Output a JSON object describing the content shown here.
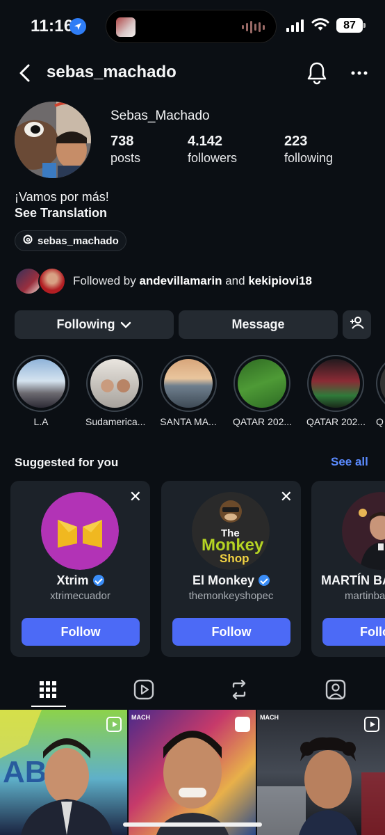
{
  "status_bar": {
    "time": "11:16",
    "battery": "87"
  },
  "header": {
    "username": "sebas_machado"
  },
  "profile": {
    "display_name": "Sebas_Machado",
    "stats": [
      {
        "value": "738",
        "label": "posts"
      },
      {
        "value": "4.142",
        "label": "followers"
      },
      {
        "value": "223",
        "label": "following"
      }
    ],
    "bio": "¡Vamos por más!",
    "see_translation": "See Translation",
    "threads_handle": "sebas_machado",
    "followed_by_prefix": "Followed by ",
    "followed_by_user1": "andevillamarin",
    "followed_by_and": " and ",
    "followed_by_user2": "kekipiovi18"
  },
  "actions": {
    "following": "Following",
    "message": "Message"
  },
  "highlights": [
    {
      "label": "L.A"
    },
    {
      "label": "Sudamerica..."
    },
    {
      "label": "SANTA MA..."
    },
    {
      "label": "QATAR 202..."
    },
    {
      "label": "QATAR 202..."
    },
    {
      "label": "Q"
    }
  ],
  "suggested": {
    "title": "Suggested for you",
    "see_all": "See all",
    "cards": [
      {
        "name": "Xtrim",
        "handle": "xtrimecuador",
        "button": "Follow",
        "verified": true
      },
      {
        "name": "El Monkey",
        "handle": "themonkeyshopec",
        "button": "Follow",
        "verified": true,
        "logo_text_1": "The",
        "logo_text_2": "Monkey",
        "logo_text_3": "Shop"
      },
      {
        "name": "MARTÍN BA",
        "handle": "martinba",
        "button": "Follo"
      }
    ]
  },
  "tabs": [
    "grid-icon",
    "reels-icon",
    "reposts-icon",
    "tagged-icon"
  ],
  "grid_badges": {
    "tile2": "MACH",
    "tile3": "MACH"
  },
  "colors": {
    "accent": "#4c6af6",
    "link": "#5b8bff",
    "background": "#0b0f14",
    "button": "#242a31"
  }
}
